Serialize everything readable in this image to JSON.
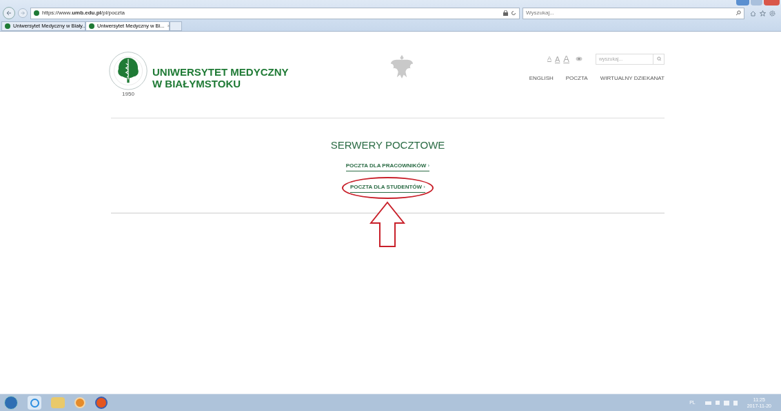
{
  "browser": {
    "address": "https://www.**umb.edu.pl**/pl/poczta",
    "search": {
      "placeholder": "Wyszukaj..."
    },
    "tabs": [
      {
        "label": "Uniwersytet Medyczny w Biały...",
        "selected": false
      },
      {
        "label": "Uniwersytet Medyczny w Bi...",
        "selected": true,
        "close": "×"
      }
    ]
  },
  "page": {
    "logo": {
      "name_line1": "UNIWERSYTET MEDYCZNY",
      "name_line2": "W BIAŁYMSTOKU",
      "seal_year": "1950"
    },
    "font_sizes": [
      "A",
      "A",
      "A"
    ],
    "search": {
      "placeholder": "wyszukaj..."
    },
    "nav": [
      "ENGLISH",
      "POCZTA",
      "WIRTUALNY DZIEKANAT"
    ],
    "heading": "SERWERY POCZTOWE",
    "links": [
      {
        "label": "POCZTA DLA PRACOWNIKÓW",
        "marker": "›",
        "highlighted": false
      },
      {
        "label": "POCZTA DLA STUDENTÓW",
        "marker": "›",
        "highlighted": true
      }
    ]
  },
  "taskbar": {
    "language": "PL",
    "time": "11:25",
    "date": "2017-11-20"
  }
}
